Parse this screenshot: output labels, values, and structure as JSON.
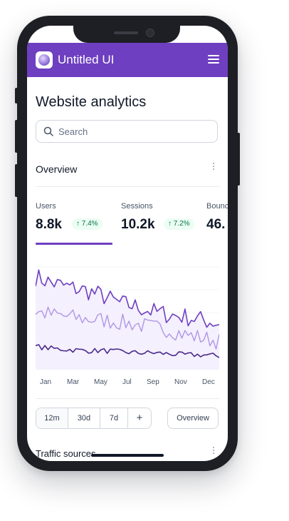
{
  "app": {
    "brand": "Untitled UI"
  },
  "page": {
    "title": "Website analytics"
  },
  "search": {
    "placeholder": "Search"
  },
  "overview": {
    "title": "Overview",
    "metrics": [
      {
        "label": "Users",
        "value": "8.8k",
        "change": "↑ 7.4%"
      },
      {
        "label": "Sessions",
        "value": "10.2k",
        "change": "↑ 7.2%"
      },
      {
        "label": "Bounce",
        "value": "46."
      }
    ],
    "active_metric": "Users"
  },
  "chart_data": {
    "type": "line",
    "x": [
      "Jan",
      "Mar",
      "May",
      "Jul",
      "Sep",
      "Nov",
      "Dec"
    ],
    "series": [
      {
        "values": [
          0.88,
          0.82,
          0.78,
          0.75,
          0.7,
          0.63,
          0.6,
          0.55,
          0.52,
          0.5,
          0.47,
          0.44
        ]
      },
      {
        "values": [
          0.55,
          0.52,
          0.5,
          0.48,
          0.47,
          0.45,
          0.43,
          0.4,
          0.38,
          0.33,
          0.3,
          0.27
        ]
      },
      {
        "values": [
          0.22,
          0.2,
          0.19,
          0.18,
          0.18,
          0.17,
          0.16,
          0.16,
          0.15,
          0.14,
          0.14,
          0.13
        ]
      }
    ],
    "colors": [
      "#6e3fc0",
      "#b095e8",
      "#4a2a8a"
    ],
    "grid": true
  },
  "range_tabs": [
    "12m",
    "30d",
    "7d",
    "+"
  ],
  "range_selected": "12m",
  "overview_button": "Overview",
  "traffic": {
    "title": "Traffic sources"
  },
  "colors": {
    "brand": "#6e3fc0",
    "success_bg": "#ecfdf3",
    "success_text": "#067647"
  }
}
